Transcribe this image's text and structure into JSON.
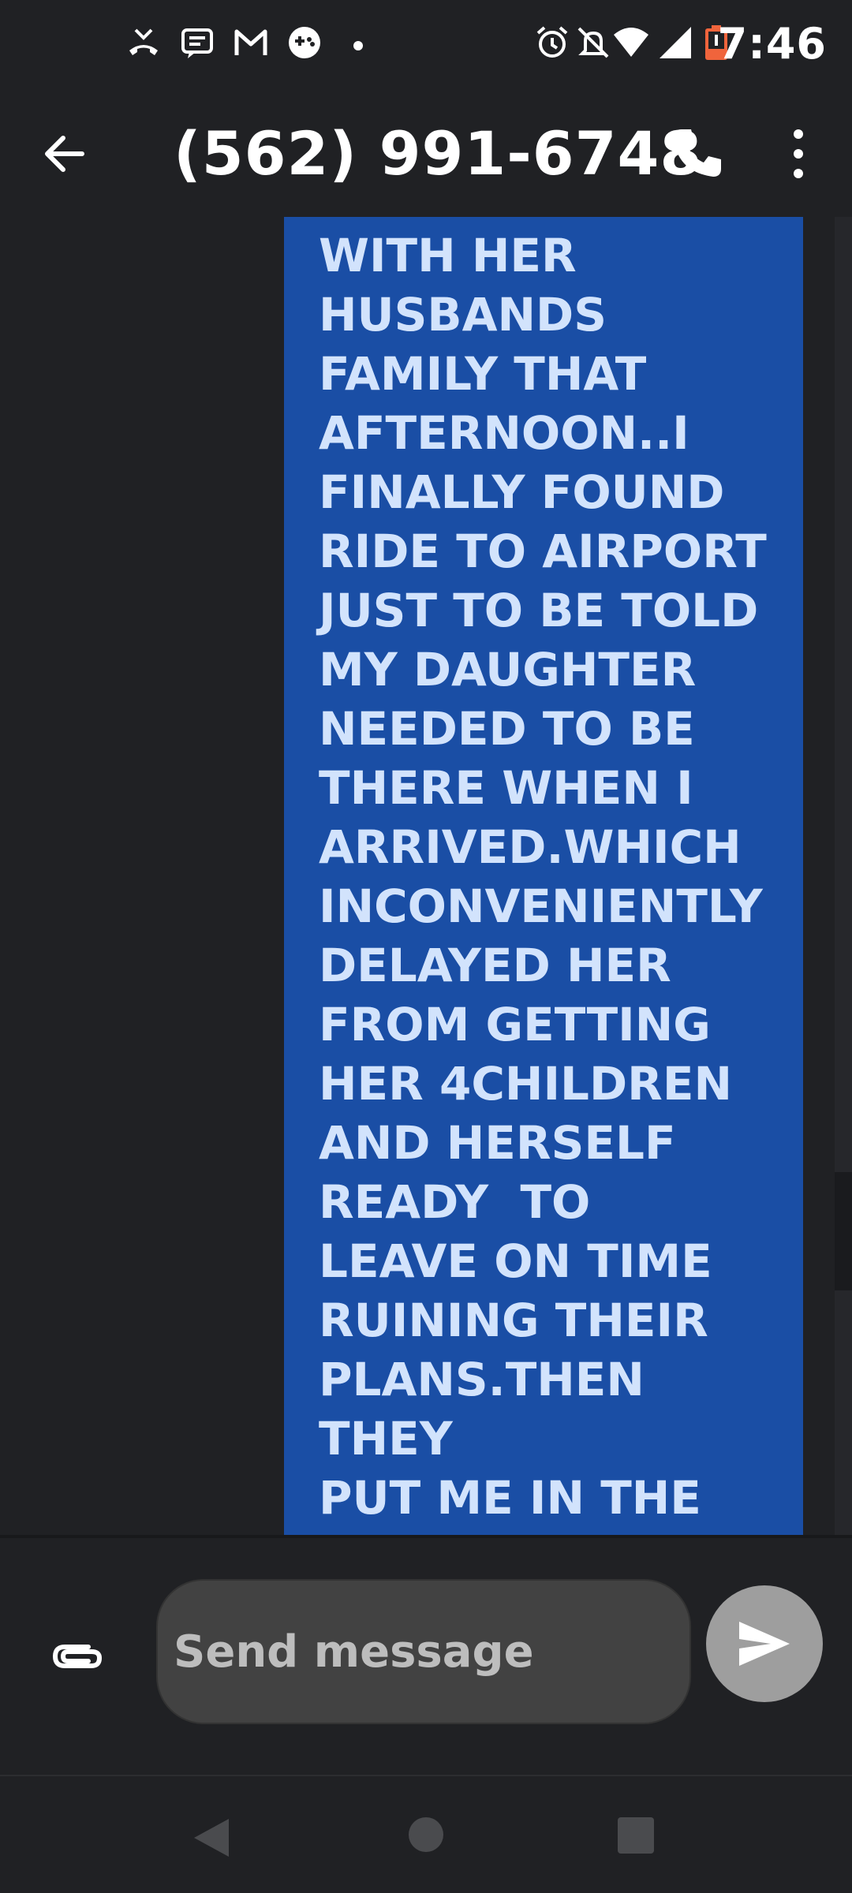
{
  "status_bar": {
    "time": "7:46",
    "icons": [
      "missed-call-icon",
      "message-notification-icon",
      "gmail-icon",
      "game-controller-icon",
      "notification-dot-icon",
      "alarm-icon",
      "notifications-off-icon",
      "wifi-icon",
      "cellular-signal-icon",
      "battery-low-icon"
    ],
    "battery_color": "#f0643c"
  },
  "app_bar": {
    "title": "(562) 991-6748",
    "icons": [
      "back-arrow-icon",
      "phone-icon",
      "more-vert-icon"
    ]
  },
  "conversation": {
    "message_text": "WITH HER\nHUSBANDS\nFAMILY THAT\nAFTERNOON..I\nFINALLY FOUND\nRIDE TO AIRPORT\nJUST TO BE TOLD\nMY DAUGHTER\nNEEDED TO BE\nTHERE WHEN I\nARRIVED.WHICH\nINCONVENIENTLY\nDELAYED HER\nFROM GETTING\nHER 4CHILDREN\nAND HERSELF\nREADY  TO\nLEAVE ON TIME\nRUINING THEIR\nPLANS.THEN THEY\nPUT ME IN THE\nWRONG SIZE CAR\nI WAS PAYING",
    "bubble_color": "#1a4ea5",
    "text_color": "#d2e3fc"
  },
  "compose": {
    "placeholder": "Send message",
    "icons": [
      "attachment-icon",
      "send-icon"
    ]
  },
  "nav_bar": {
    "icons": [
      "nav-back-icon",
      "nav-home-icon",
      "nav-recents-icon"
    ]
  }
}
